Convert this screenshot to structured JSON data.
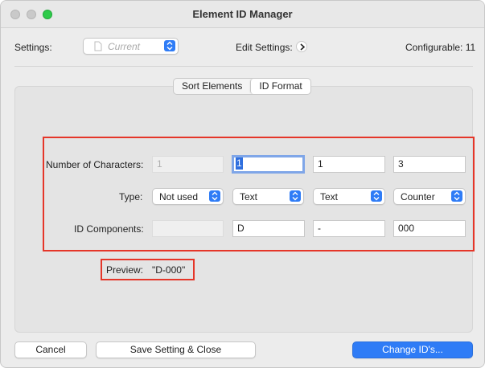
{
  "window": {
    "title": "Element ID Manager"
  },
  "header": {
    "settings_label": "Settings:",
    "settings_value": "Current",
    "edit_settings_label": "Edit Settings:",
    "configurable_text": "Configurable: 11"
  },
  "tabs": [
    {
      "label": "Sort Elements",
      "active": false
    },
    {
      "label": "ID Format",
      "active": true
    }
  ],
  "format": {
    "row_labels": {
      "num_chars": "Number of Characters:",
      "type": "Type:",
      "components": "ID Components:"
    },
    "columns": [
      {
        "num_chars": "1",
        "type": "Not used",
        "component": ""
      },
      {
        "num_chars": "1",
        "type": "Text",
        "component": "D"
      },
      {
        "num_chars": "1",
        "type": "Text",
        "component": "-"
      },
      {
        "num_chars": "3",
        "type": "Counter",
        "component": "000"
      }
    ]
  },
  "preview": {
    "label": "Preview:",
    "value": "\"D-000\""
  },
  "footer": {
    "cancel": "Cancel",
    "save_close": "Save Setting & Close",
    "change_ids": "Change ID's..."
  },
  "colors": {
    "accent": "#2f7cf6",
    "highlight_box": "#e53629",
    "focus_ring": "#7fa6e8"
  },
  "icons": [
    "document-icon",
    "chevron-updown-icon",
    "chevron-right-icon"
  ]
}
